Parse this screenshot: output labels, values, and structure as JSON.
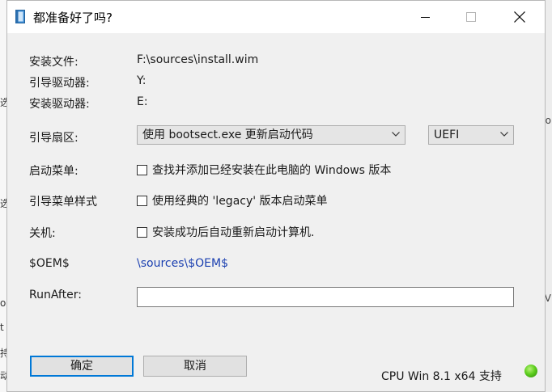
{
  "window": {
    "title": "都准备好了吗?"
  },
  "fields": {
    "install_file_label": "安装文件:",
    "install_file_value": "F:\\sources\\install.wim",
    "boot_drive_label": "引导驱动器:",
    "boot_drive_value": "Y:",
    "install_drive_label": "安装驱动器:",
    "install_drive_value": "E:",
    "boot_sector_label": "引导扇区:",
    "boot_sector_selected": "使用 bootsect.exe 更新启动代码",
    "firmware_selected": "UEFI",
    "boot_menu_label": "启动菜单:",
    "boot_menu_checkbox": "查找并添加已经安装在此电脑的 Windows 版本",
    "boot_menu_style_label": "引导菜单样式",
    "boot_menu_style_checkbox": "使用经典的 'legacy' 版本启动菜单",
    "shutdown_label": "关机:",
    "shutdown_checkbox": "安装成功后自动重新启动计算机.",
    "oem_label": "$OEM$",
    "oem_value": "\\sources\\$OEM$",
    "runafter_label": "RunAfter:",
    "runafter_value": ""
  },
  "checkboxes": {
    "boot_menu_checked": false,
    "boot_menu_style_checked": false,
    "shutdown_checked": false
  },
  "buttons": {
    "ok": "确定",
    "cancel": "取消"
  },
  "status": {
    "text": "CPU Win 8.1 x64 支持",
    "indicator_color": "#5fcf1f"
  },
  "icons": {
    "app": "document-icon",
    "minimize": "minimize-icon",
    "maximize": "maximize-icon",
    "close": "close-icon",
    "dropdown": "chevron-down-icon"
  }
}
